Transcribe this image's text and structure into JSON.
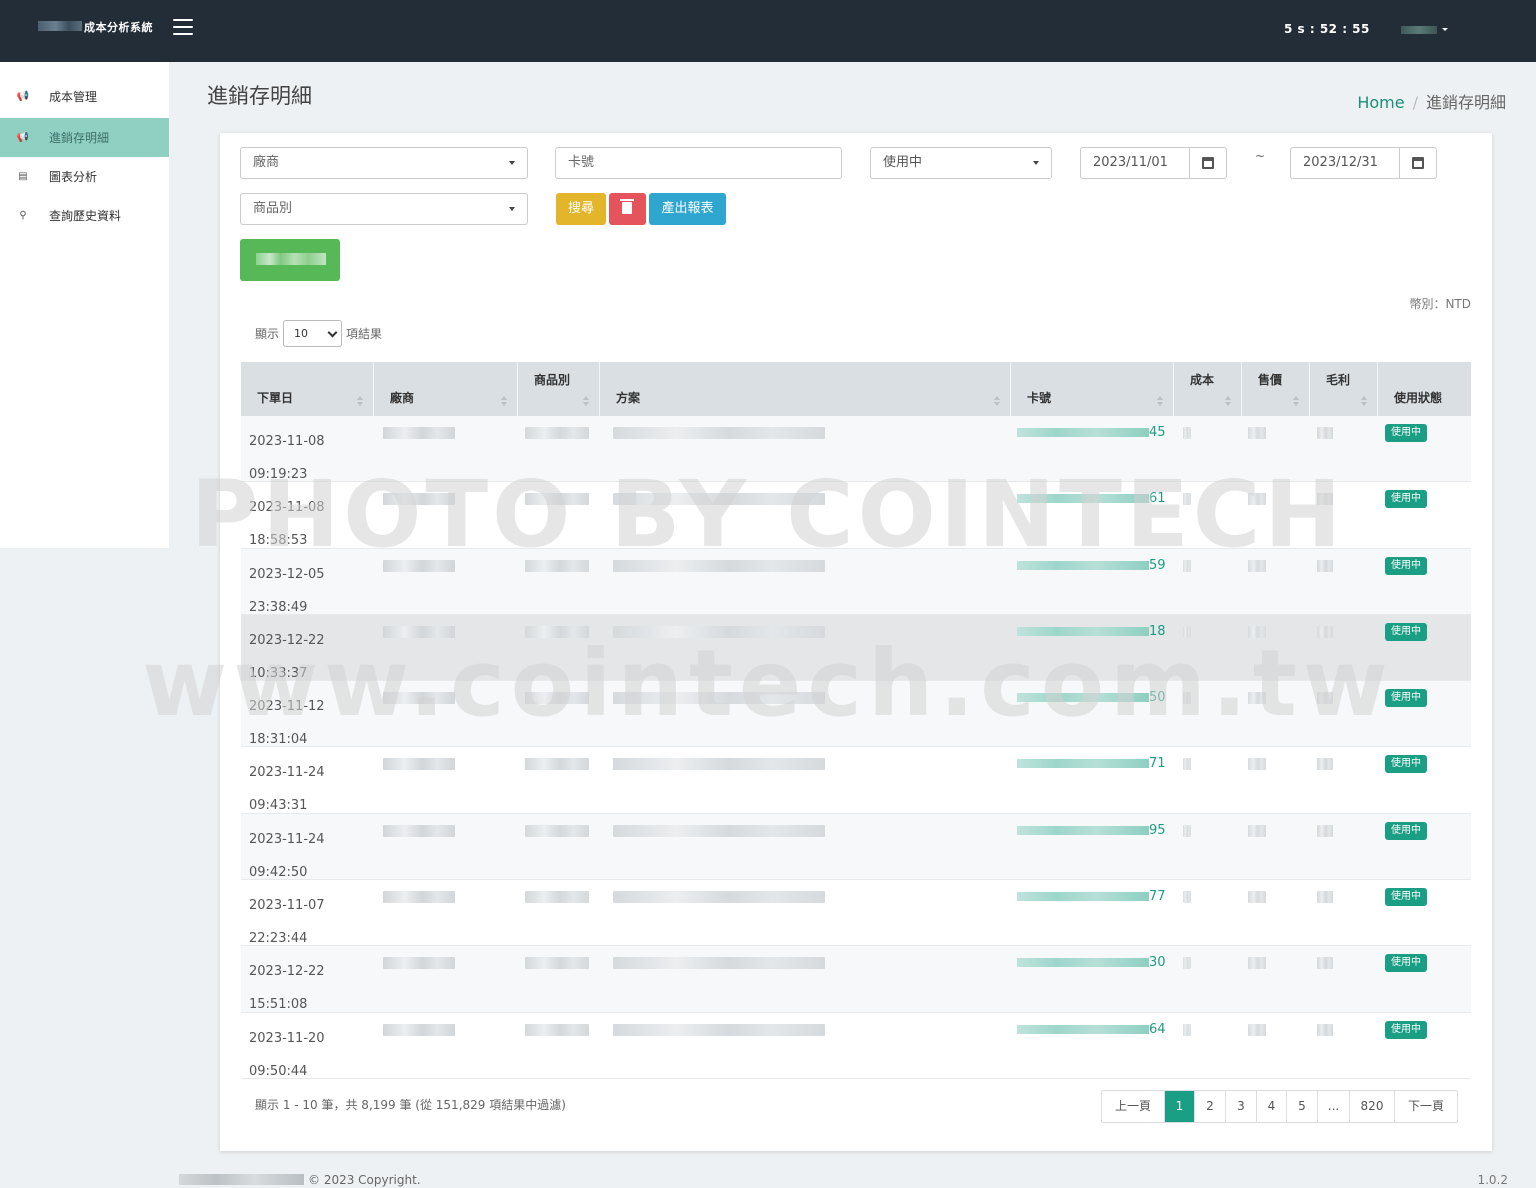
{
  "header": {
    "brand": "成本分析系統",
    "timer": "5 s : 52 : 55"
  },
  "sidebar": {
    "items": [
      {
        "label": "成本管理",
        "icon": "megaphone-icon",
        "glyph": "📢"
      },
      {
        "label": "進銷存明細",
        "icon": "megaphone-icon",
        "glyph": "📢"
      },
      {
        "label": "圖表分析",
        "icon": "chart-icon",
        "glyph": "▤"
      },
      {
        "label": "查詢歷史資料",
        "icon": "search-icon",
        "glyph": "⚲"
      }
    ]
  },
  "page": {
    "title": "進銷存明細",
    "breadcrumb_home": "Home",
    "breadcrumb_sep": "/",
    "breadcrumb_current": "進銷存明細"
  },
  "filters": {
    "vendor_placeholder": "廠商",
    "card_placeholder": "卡號",
    "status_value": "使用中",
    "date_from": "2023/11/01",
    "date_sep": "~",
    "date_to": "2023/12/31",
    "category_placeholder": "商品別",
    "search_label": "搜尋",
    "export_label": "產出報表"
  },
  "currency": "幣別：NTD",
  "length_menu": {
    "prefix": "顯示",
    "value": "10",
    "suffix": "項結果"
  },
  "table": {
    "columns": [
      "下單日",
      "廠商",
      "商品別",
      "方案",
      "卡號",
      "成本",
      "售價",
      "毛利",
      "使用狀態"
    ],
    "rows": [
      {
        "date": "2023-11-08",
        "time": "09:19:23",
        "card_tail": "45",
        "status": "使用中"
      },
      {
        "date": "2023-11-08",
        "time": "18:58:53",
        "card_tail": "61",
        "status": "使用中"
      },
      {
        "date": "2023-12-05",
        "time": "23:38:49",
        "card_tail": "59",
        "status": "使用中"
      },
      {
        "date": "2023-12-22",
        "time": "10:33:37",
        "card_tail": "18",
        "status": "使用中"
      },
      {
        "date": "2023-11-12",
        "time": "18:31:04",
        "card_tail": "50",
        "status": "使用中"
      },
      {
        "date": "2023-11-24",
        "time": "09:43:31",
        "card_tail": "71",
        "status": "使用中"
      },
      {
        "date": "2023-11-24",
        "time": "09:42:50",
        "card_tail": "95",
        "status": "使用中"
      },
      {
        "date": "2023-11-07",
        "time": "22:23:44",
        "card_tail": "77",
        "status": "使用中"
      },
      {
        "date": "2023-12-22",
        "time": "15:51:08",
        "card_tail": "30",
        "status": "使用中"
      },
      {
        "date": "2023-11-20",
        "time": "09:50:44",
        "card_tail": "64",
        "status": "使用中"
      }
    ]
  },
  "pagination": {
    "info": "顯示 1 - 10 筆，共 8,199 筆 (從 151,829 項結果中過濾)",
    "prev": "上一頁",
    "pages": [
      "1",
      "2",
      "3",
      "4",
      "5",
      "...",
      "820"
    ],
    "next": "下一頁",
    "active": "1"
  },
  "watermark": {
    "line1": "PHOTO BY COINTECH",
    "line2": "www.cointech.com.tw"
  },
  "footer": {
    "copyright": "© 2023 Copyright.",
    "version": "1.0.2"
  },
  "colors": {
    "accent": "#1a9e84",
    "topbar": "#222d38",
    "sidebar_active": "#8fd0c3",
    "search": "#e3b52a",
    "delete": "#e5545d",
    "export": "#2fa6d0",
    "green": "#57b857"
  }
}
